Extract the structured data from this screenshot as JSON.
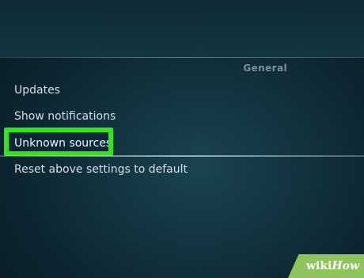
{
  "settings": {
    "section_header": "General",
    "items": [
      {
        "label": "Updates"
      },
      {
        "label": "Show notifications"
      },
      {
        "label": "Unknown sources"
      },
      {
        "label": "Reset above settings to default"
      }
    ]
  },
  "watermark": {
    "part1": "wiki",
    "part2": "How"
  },
  "colors": {
    "highlight": "#36e21a",
    "background": "#12333f",
    "text": "#d7dfe3",
    "watermark": "#8fc45c"
  }
}
